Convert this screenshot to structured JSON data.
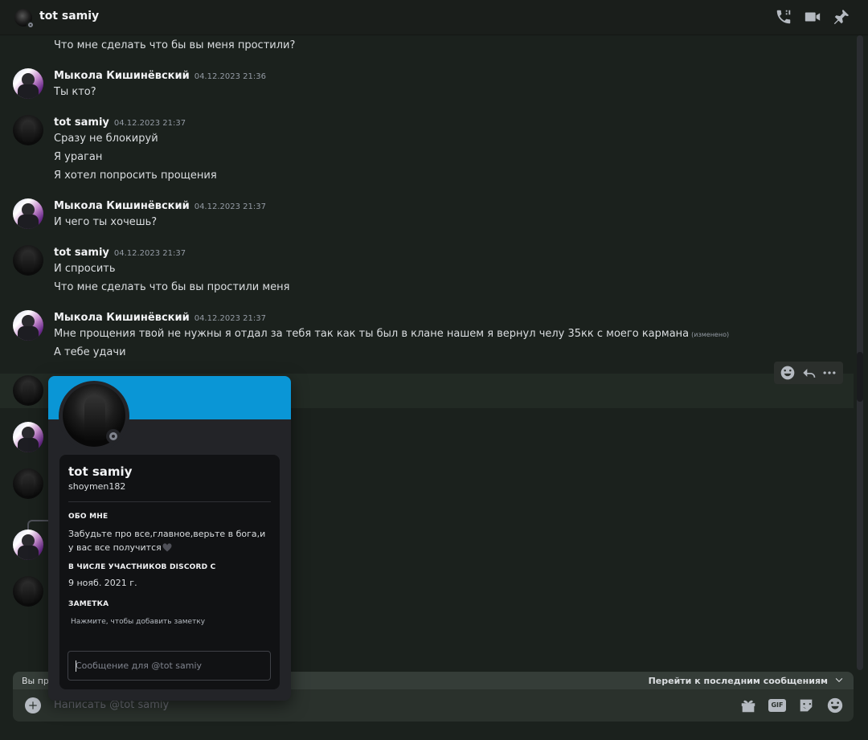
{
  "header": {
    "title": "tot samiy",
    "icons": [
      "phone-call-icon",
      "video-call-icon",
      "pin-icon"
    ]
  },
  "messages": {
    "m0": "Что мне сделать что бы вы меня простили?",
    "g1": {
      "author": "Мыкола Кишинёвский",
      "timestamp": "04.12.2023 21:36",
      "lines": [
        "Ты кто?"
      ]
    },
    "g2": {
      "author": "tot samiy",
      "timestamp": "04.12.2023 21:37",
      "lines": [
        "Сразу не блокируй",
        "Я ураган",
        "Я хотел попросить прощения"
      ]
    },
    "g3": {
      "author": "Мыкола Кишинёвский",
      "timestamp": "04.12.2023 21:37",
      "lines": [
        "И чего ты хочешь?"
      ]
    },
    "g4": {
      "author": "tot samiy",
      "timestamp": "04.12.2023 21:37",
      "lines": [
        "И спросить",
        "Что мне сделать что бы вы простили меня"
      ]
    },
    "g5": {
      "author": "Мыкола Кишинёвский",
      "timestamp": "04.12.2023 21:37",
      "lines": [
        "Мне прощения твой не нужны я отдал за тебя так как ты был в клане нашем я вернул челу 35кк с моего кармана",
        "А тебе удачи"
      ],
      "edited": "(изменено)"
    }
  },
  "profile": {
    "display_name": "tot samiy",
    "username": "shoymen182",
    "about_heading": "ОБО МНЕ",
    "about_text": "Забудьте про все,главное,верьте в бога,и у вас все получится",
    "member_heading": "В ЧИСЛЕ УЧАСТНИКОВ DISCORD С",
    "member_since": "9 нояб. 2021 г.",
    "note_heading": "ЗАМЕТКА",
    "note_placeholder": "Нажмите, чтобы добавить заметку",
    "message_placeholder": "Сообщение для @tot samiy",
    "banner_color": "#0a96d6",
    "status": "offline"
  },
  "jumpbar": {
    "left_text": "Вы пр",
    "jump_label": "Перейти к последним сообщениям"
  },
  "composer": {
    "placeholder": "Написать @tot samiy",
    "gif_label": "GIF",
    "icons": [
      "gift-icon",
      "gif-icon",
      "sticker-icon",
      "emoji-icon"
    ]
  },
  "colors": {
    "background": "#1b211d",
    "accent": "#0a96d6"
  }
}
